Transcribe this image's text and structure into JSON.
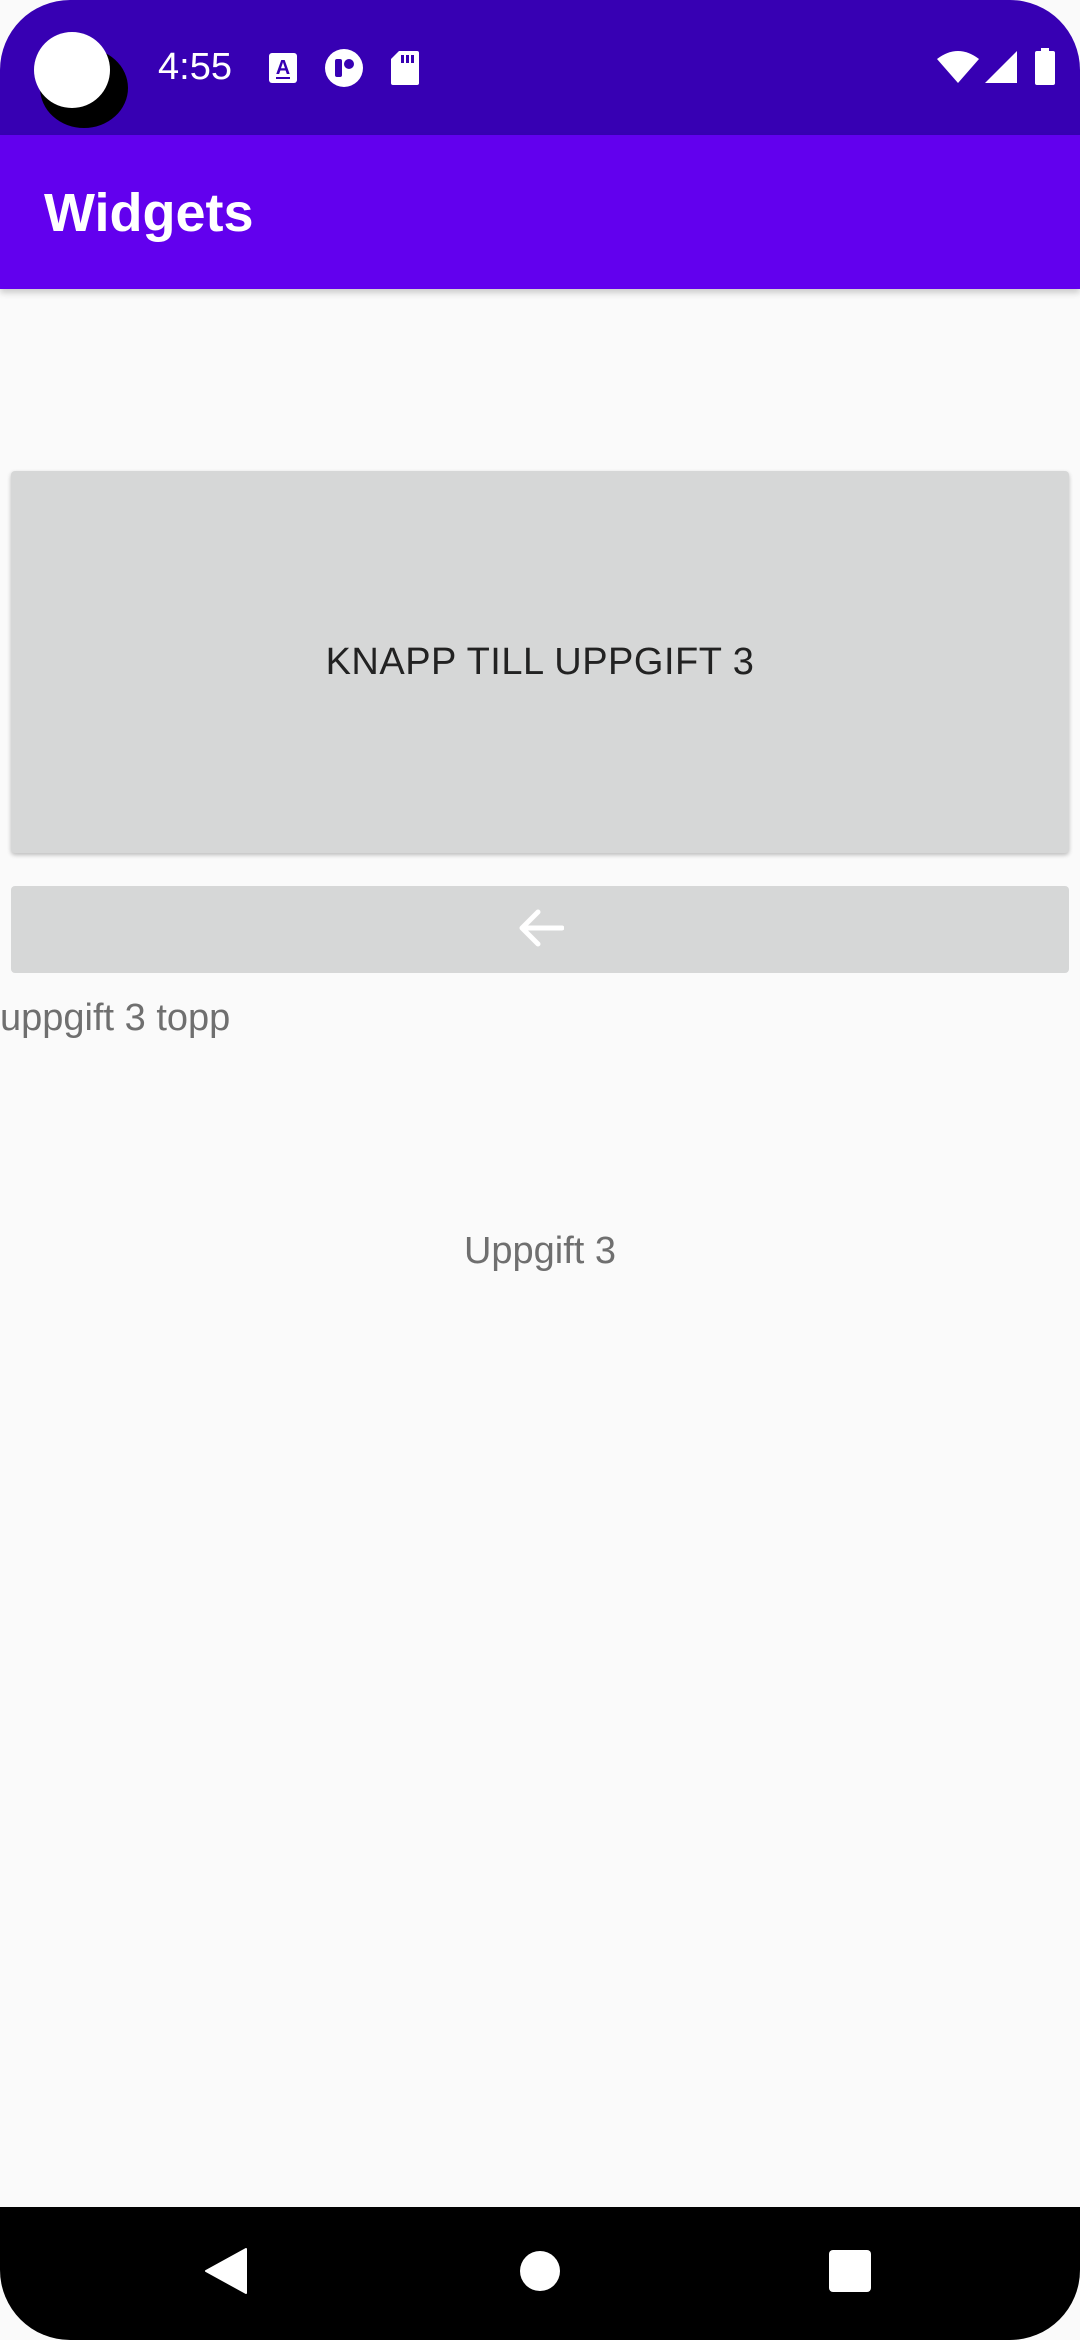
{
  "status_bar": {
    "time": "4:55",
    "left_icons": [
      "a-text-icon",
      "record-icon",
      "sd-card-icon"
    ],
    "right_icons": [
      "wifi-icon",
      "signal-icon",
      "battery-icon"
    ],
    "background": "#3700b3"
  },
  "app_bar": {
    "title": "Widgets",
    "background": "#6200ee"
  },
  "main": {
    "big_button_label": "KNAPP TILL UPPGIFT 3",
    "arrow_button_icon": "arrow-left-icon",
    "topp_label": "uppgift 3 topp",
    "uppgift_label": "Uppgift 3"
  },
  "nav_bar": {
    "buttons": [
      "back-icon",
      "home-icon",
      "recents-icon"
    ]
  }
}
